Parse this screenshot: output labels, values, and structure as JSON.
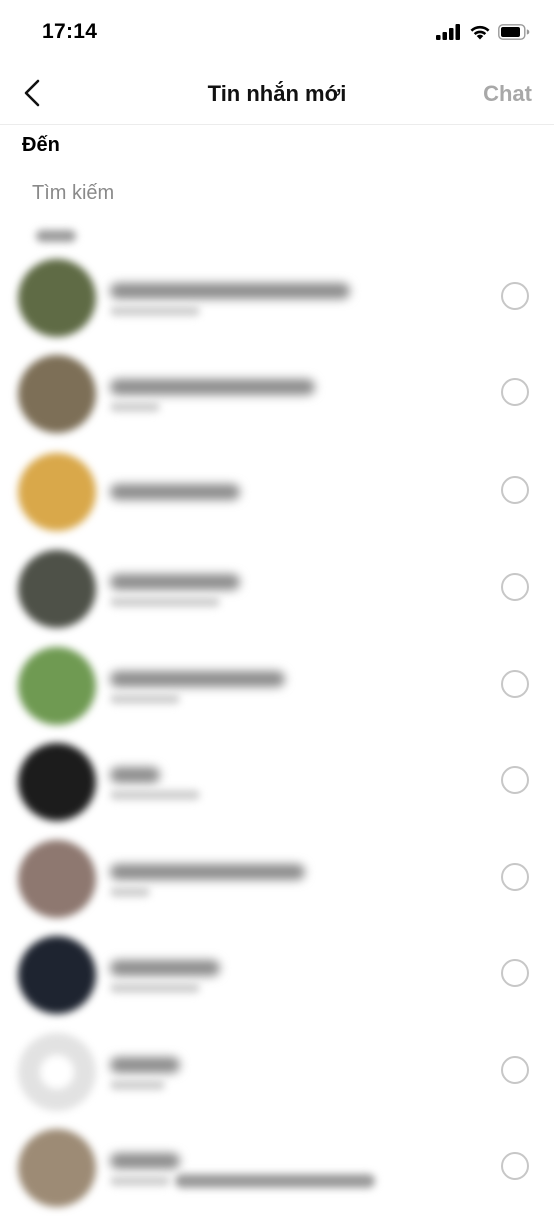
{
  "status_bar": {
    "time": "17:14",
    "icons": [
      "cellular-signal-icon",
      "wifi-icon",
      "battery-icon"
    ]
  },
  "nav": {
    "back_icon": "chevron-left-icon",
    "title": "Tin nhắn mới",
    "action_label": "Chat"
  },
  "recipient": {
    "label": "Đến",
    "search_placeholder": "Tìm kiếm",
    "search_value": ""
  },
  "section_header_blurred": true,
  "contacts": [
    {
      "name_blurred": true,
      "avatar_color": "#5f6b45",
      "selected": false
    },
    {
      "name_blurred": true,
      "avatar_color": "#7d6f57",
      "selected": false
    },
    {
      "name_blurred": true,
      "avatar_color": "#d9a84a",
      "selected": false
    },
    {
      "name_blurred": true,
      "avatar_color": "#4e5148",
      "selected": false
    },
    {
      "name_blurred": true,
      "avatar_color": "#6f9a52",
      "selected": false
    },
    {
      "name_blurred": true,
      "avatar_color": "#1c1c1c",
      "selected": false
    },
    {
      "name_blurred": true,
      "avatar_color": "#8e7870",
      "selected": false
    },
    {
      "name_blurred": true,
      "avatar_color": "#1e2430",
      "selected": false
    },
    {
      "name_blurred": true,
      "avatar_color": "#e6e6e6",
      "selected": false
    },
    {
      "name_blurred": true,
      "avatar_color": "#9d8b75",
      "selected": false
    }
  ],
  "colors": {
    "action_disabled": "#a8a8a8",
    "radio_border": "#c7c7c7",
    "placeholder": "#8a8a8a"
  }
}
